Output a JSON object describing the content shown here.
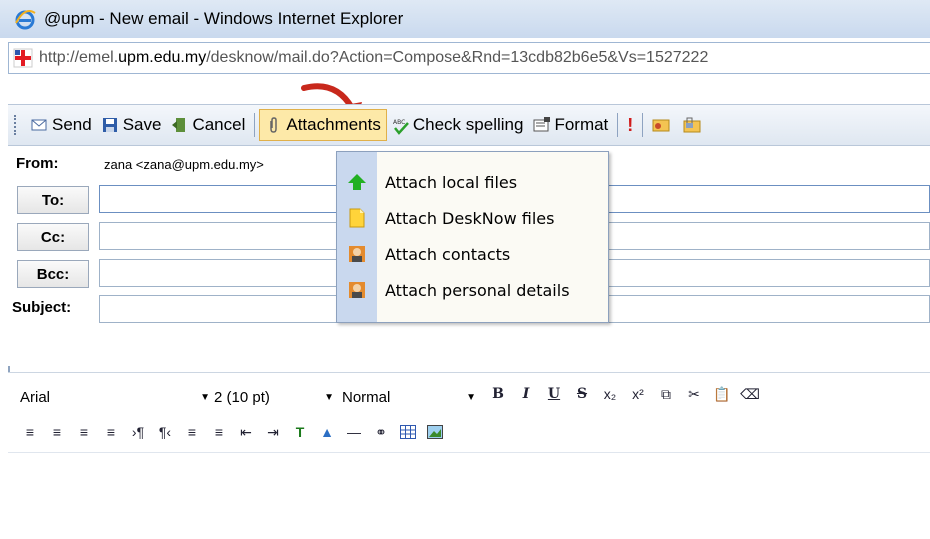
{
  "window": {
    "title": "@upm - New email - Windows Internet Explorer"
  },
  "address": {
    "prefix": "http://emel.",
    "domain": "upm.edu.my",
    "path": "/desknow/mail.do?Action=Compose&Rnd=13cdb82b6e5&Vs=1527222"
  },
  "toolbar": {
    "send_label": "Send",
    "save_label": "Save",
    "cancel_label": "Cancel",
    "attachments_label": "Attachments",
    "spell_label": "Check spelling",
    "format_label": "Format"
  },
  "form": {
    "from_label": "From:",
    "from_value": "zana <zana@upm.edu.my>",
    "to_label": "To:",
    "cc_label": "Cc:",
    "bcc_label": "Bcc:",
    "subject_label": "Subject:"
  },
  "editor": {
    "font_value": "Arial",
    "size_value": "2 (10 pt)",
    "style_value": "Normal"
  },
  "attach_menu": {
    "items": [
      {
        "label": "Attach local files",
        "icon": "green-up-arrow-icon"
      },
      {
        "label": "Attach DeskNow files",
        "icon": "document-icon"
      },
      {
        "label": "Attach contacts",
        "icon": "contact-card-icon"
      },
      {
        "label": "Attach personal details",
        "icon": "contact-card-icon"
      }
    ]
  },
  "colors": {
    "accent": "#fde9a8",
    "menu_gutter": "#c9d8ee",
    "arrow": "#c8281c"
  }
}
